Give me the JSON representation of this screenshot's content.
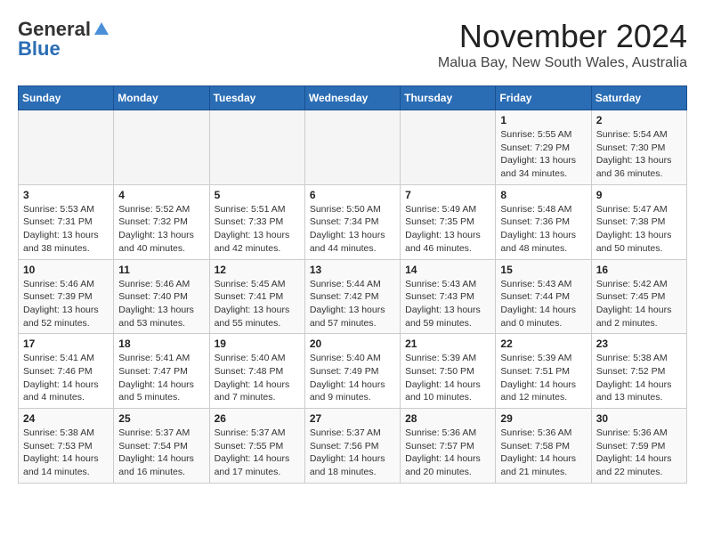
{
  "header": {
    "logo_line1": "General",
    "logo_line2": "Blue",
    "month": "November 2024",
    "location": "Malua Bay, New South Wales, Australia"
  },
  "weekdays": [
    "Sunday",
    "Monday",
    "Tuesday",
    "Wednesday",
    "Thursday",
    "Friday",
    "Saturday"
  ],
  "weeks": [
    [
      {
        "day": "",
        "info": ""
      },
      {
        "day": "",
        "info": ""
      },
      {
        "day": "",
        "info": ""
      },
      {
        "day": "",
        "info": ""
      },
      {
        "day": "",
        "info": ""
      },
      {
        "day": "1",
        "info": "Sunrise: 5:55 AM\nSunset: 7:29 PM\nDaylight: 13 hours\nand 34 minutes."
      },
      {
        "day": "2",
        "info": "Sunrise: 5:54 AM\nSunset: 7:30 PM\nDaylight: 13 hours\nand 36 minutes."
      }
    ],
    [
      {
        "day": "3",
        "info": "Sunrise: 5:53 AM\nSunset: 7:31 PM\nDaylight: 13 hours\nand 38 minutes."
      },
      {
        "day": "4",
        "info": "Sunrise: 5:52 AM\nSunset: 7:32 PM\nDaylight: 13 hours\nand 40 minutes."
      },
      {
        "day": "5",
        "info": "Sunrise: 5:51 AM\nSunset: 7:33 PM\nDaylight: 13 hours\nand 42 minutes."
      },
      {
        "day": "6",
        "info": "Sunrise: 5:50 AM\nSunset: 7:34 PM\nDaylight: 13 hours\nand 44 minutes."
      },
      {
        "day": "7",
        "info": "Sunrise: 5:49 AM\nSunset: 7:35 PM\nDaylight: 13 hours\nand 46 minutes."
      },
      {
        "day": "8",
        "info": "Sunrise: 5:48 AM\nSunset: 7:36 PM\nDaylight: 13 hours\nand 48 minutes."
      },
      {
        "day": "9",
        "info": "Sunrise: 5:47 AM\nSunset: 7:38 PM\nDaylight: 13 hours\nand 50 minutes."
      }
    ],
    [
      {
        "day": "10",
        "info": "Sunrise: 5:46 AM\nSunset: 7:39 PM\nDaylight: 13 hours\nand 52 minutes."
      },
      {
        "day": "11",
        "info": "Sunrise: 5:46 AM\nSunset: 7:40 PM\nDaylight: 13 hours\nand 53 minutes."
      },
      {
        "day": "12",
        "info": "Sunrise: 5:45 AM\nSunset: 7:41 PM\nDaylight: 13 hours\nand 55 minutes."
      },
      {
        "day": "13",
        "info": "Sunrise: 5:44 AM\nSunset: 7:42 PM\nDaylight: 13 hours\nand 57 minutes."
      },
      {
        "day": "14",
        "info": "Sunrise: 5:43 AM\nSunset: 7:43 PM\nDaylight: 13 hours\nand 59 minutes."
      },
      {
        "day": "15",
        "info": "Sunrise: 5:43 AM\nSunset: 7:44 PM\nDaylight: 14 hours\nand 0 minutes."
      },
      {
        "day": "16",
        "info": "Sunrise: 5:42 AM\nSunset: 7:45 PM\nDaylight: 14 hours\nand 2 minutes."
      }
    ],
    [
      {
        "day": "17",
        "info": "Sunrise: 5:41 AM\nSunset: 7:46 PM\nDaylight: 14 hours\nand 4 minutes."
      },
      {
        "day": "18",
        "info": "Sunrise: 5:41 AM\nSunset: 7:47 PM\nDaylight: 14 hours\nand 5 minutes."
      },
      {
        "day": "19",
        "info": "Sunrise: 5:40 AM\nSunset: 7:48 PM\nDaylight: 14 hours\nand 7 minutes."
      },
      {
        "day": "20",
        "info": "Sunrise: 5:40 AM\nSunset: 7:49 PM\nDaylight: 14 hours\nand 9 minutes."
      },
      {
        "day": "21",
        "info": "Sunrise: 5:39 AM\nSunset: 7:50 PM\nDaylight: 14 hours\nand 10 minutes."
      },
      {
        "day": "22",
        "info": "Sunrise: 5:39 AM\nSunset: 7:51 PM\nDaylight: 14 hours\nand 12 minutes."
      },
      {
        "day": "23",
        "info": "Sunrise: 5:38 AM\nSunset: 7:52 PM\nDaylight: 14 hours\nand 13 minutes."
      }
    ],
    [
      {
        "day": "24",
        "info": "Sunrise: 5:38 AM\nSunset: 7:53 PM\nDaylight: 14 hours\nand 14 minutes."
      },
      {
        "day": "25",
        "info": "Sunrise: 5:37 AM\nSunset: 7:54 PM\nDaylight: 14 hours\nand 16 minutes."
      },
      {
        "day": "26",
        "info": "Sunrise: 5:37 AM\nSunset: 7:55 PM\nDaylight: 14 hours\nand 17 minutes."
      },
      {
        "day": "27",
        "info": "Sunrise: 5:37 AM\nSunset: 7:56 PM\nDaylight: 14 hours\nand 18 minutes."
      },
      {
        "day": "28",
        "info": "Sunrise: 5:36 AM\nSunset: 7:57 PM\nDaylight: 14 hours\nand 20 minutes."
      },
      {
        "day": "29",
        "info": "Sunrise: 5:36 AM\nSunset: 7:58 PM\nDaylight: 14 hours\nand 21 minutes."
      },
      {
        "day": "30",
        "info": "Sunrise: 5:36 AM\nSunset: 7:59 PM\nDaylight: 14 hours\nand 22 minutes."
      }
    ]
  ]
}
